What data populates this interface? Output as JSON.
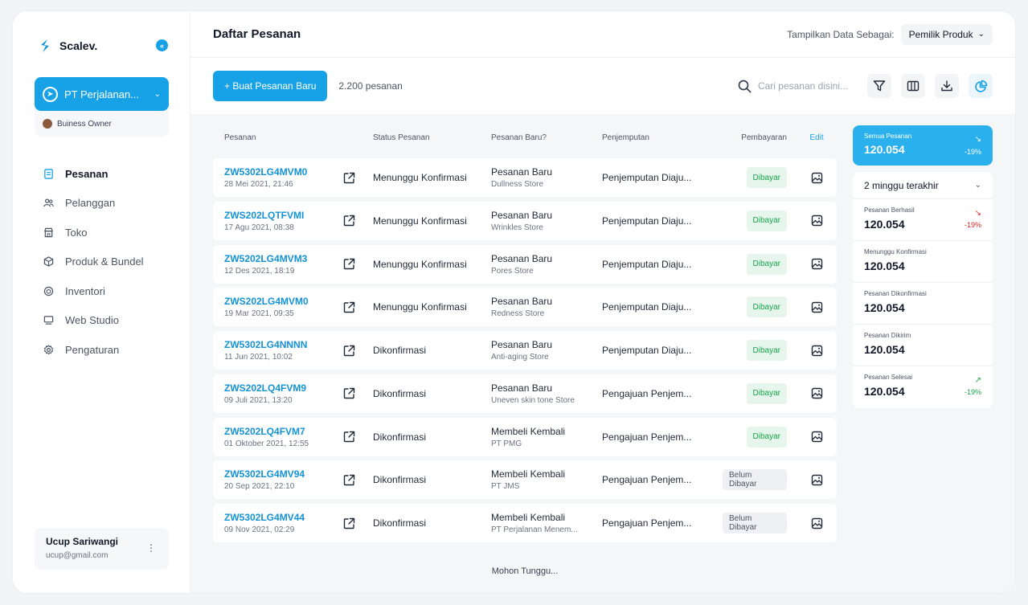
{
  "brand": {
    "name": "Scalev.",
    "collapse_icon": "«"
  },
  "org": {
    "name": "PT Perjalanan...",
    "role": "Buiness Owner"
  },
  "nav": [
    {
      "label": "Pesanan",
      "icon": "file-icon",
      "active": true
    },
    {
      "label": "Pelanggan",
      "icon": "users-icon"
    },
    {
      "label": "Toko",
      "icon": "store-icon"
    },
    {
      "label": "Produk & Bundel",
      "icon": "box-icon"
    },
    {
      "label": "Inventori",
      "icon": "inventory-icon"
    },
    {
      "label": "Web Studio",
      "icon": "monitor-icon"
    },
    {
      "label": "Pengaturan",
      "icon": "gear-icon"
    }
  ],
  "user": {
    "name": "Ucup Sariwangi",
    "email": "ucup@gmail.com",
    "menu": "⋮"
  },
  "header": {
    "title": "Daftar Pesanan",
    "view_label": "Tampilkan Data Sebagai:",
    "view_value": "Pemilik Produk"
  },
  "toolbar": {
    "new_button": "+ Buat Pesanan Baru",
    "count": "2.200 pesanan",
    "search_placeholder": "Cari pesanan disini..."
  },
  "table": {
    "headers": {
      "order": "Pesanan",
      "status": "Status Pesanan",
      "new": "Pesanan Baru?",
      "pickup": "Penjemputan",
      "payment": "Pembayaran",
      "edit": "Edit"
    },
    "rows": [
      {
        "id": "ZW5302LG4MVM0",
        "date": "28 Mei 2021, 21:46",
        "status": "Menunggu Konfirmasi",
        "new_title": "Pesanan Baru",
        "store": "Dullness Store",
        "pickup": "Penjemputan Diaju...",
        "payment": "Dibayar",
        "paid": true
      },
      {
        "id": "ZWS202LQTFVMI",
        "date": "17 Agu 2021, 08:38",
        "status": "Menunggu Konfirmasi",
        "new_title": "Pesanan Baru",
        "store": "Wrinkles Store",
        "pickup": "Penjemputan Diaju...",
        "payment": "Dibayar",
        "paid": true
      },
      {
        "id": "ZW5202LG4MVM3",
        "date": "12 Des 2021, 18:19",
        "status": "Menunggu Konfirmasi",
        "new_title": "Pesanan Baru",
        "store": "Pores Store",
        "pickup": "Penjemputan Diaju...",
        "payment": "Dibayar",
        "paid": true
      },
      {
        "id": "ZWS202LG4MVM0",
        "date": "19 Mar 2021, 09:35",
        "status": "Menunggu Konfirmasi",
        "new_title": "Pesanan Baru",
        "store": "Redness Store",
        "pickup": "Penjemputan Diaju...",
        "payment": "Dibayar",
        "paid": true
      },
      {
        "id": "ZW5302LG4NNNN",
        "date": "11 Jun 2021, 10:02",
        "status": "Dikonfirmasi",
        "new_title": "Pesanan Baru",
        "store": "Anti-aging Store",
        "pickup": "Penjemputan Diaju...",
        "payment": "Dibayar",
        "paid": true
      },
      {
        "id": "ZWS202LQ4FVM9",
        "date": "09 Juli 2021, 13:20",
        "status": "Dikonfirmasi",
        "new_title": "Pesanan Baru",
        "store": "Uneven skin tone Store",
        "pickup": "Pengajuan Penjem...",
        "payment": "Dibayar",
        "paid": true
      },
      {
        "id": "ZW5202LQ4FVM7",
        "date": "01 Oktober 2021, 12:55",
        "status": "Dikonfirmasi",
        "new_title": "Membeli Kembali",
        "store": "PT PMG",
        "pickup": "Pengajuan Penjem...",
        "payment": "Dibayar",
        "paid": true
      },
      {
        "id": "ZW5302LG4MV94",
        "date": "20 Sep 2021, 22:10",
        "status": "Dikonfirmasi",
        "new_title": "Membeli Kembali",
        "store": "PT JMS",
        "pickup": "Pengajuan Penjem...",
        "payment": "Belum Dibayar",
        "paid": false
      },
      {
        "id": "ZW5302LG4MV44",
        "date": "09 Nov 2021, 02:29",
        "status": "Dikonfirmasi",
        "new_title": "Membeli Kembali",
        "store": "PT Perjalanan Menem...",
        "pickup": "Pengajuan Penjem...",
        "payment": "Belum Dibayar",
        "paid": false
      }
    ],
    "loading": "Mohon Tunggu..."
  },
  "stats": {
    "total": {
      "label": "Semua Pesanan",
      "value": "120.054",
      "pct": "-19%",
      "trend": "↘"
    },
    "period": "2 minggu terakhir",
    "items": [
      {
        "label": "Pesanan Berhasil",
        "value": "120.054",
        "pct": "-19%",
        "trend": "↘",
        "dir": "down"
      },
      {
        "label": "Menunggu Konfirmasi",
        "value": "120.054",
        "pct": "",
        "trend": "",
        "dir": ""
      },
      {
        "label": "Pesanan Dikonfirmasi",
        "value": "120.054",
        "pct": "",
        "trend": "",
        "dir": ""
      },
      {
        "label": "Pesanan Dikirim",
        "value": "120.054",
        "pct": "",
        "trend": "",
        "dir": ""
      },
      {
        "label": "Pesanan Selesai",
        "value": "120.054",
        "pct": "-19%",
        "trend": "↗",
        "dir": "up"
      }
    ]
  },
  "colors": {
    "accent": "#17a2e8",
    "link": "#1392d6",
    "paid_bg": "#e6f6ec",
    "paid_text": "#16a34a",
    "down": "#dc2626",
    "up": "#16a34a"
  }
}
